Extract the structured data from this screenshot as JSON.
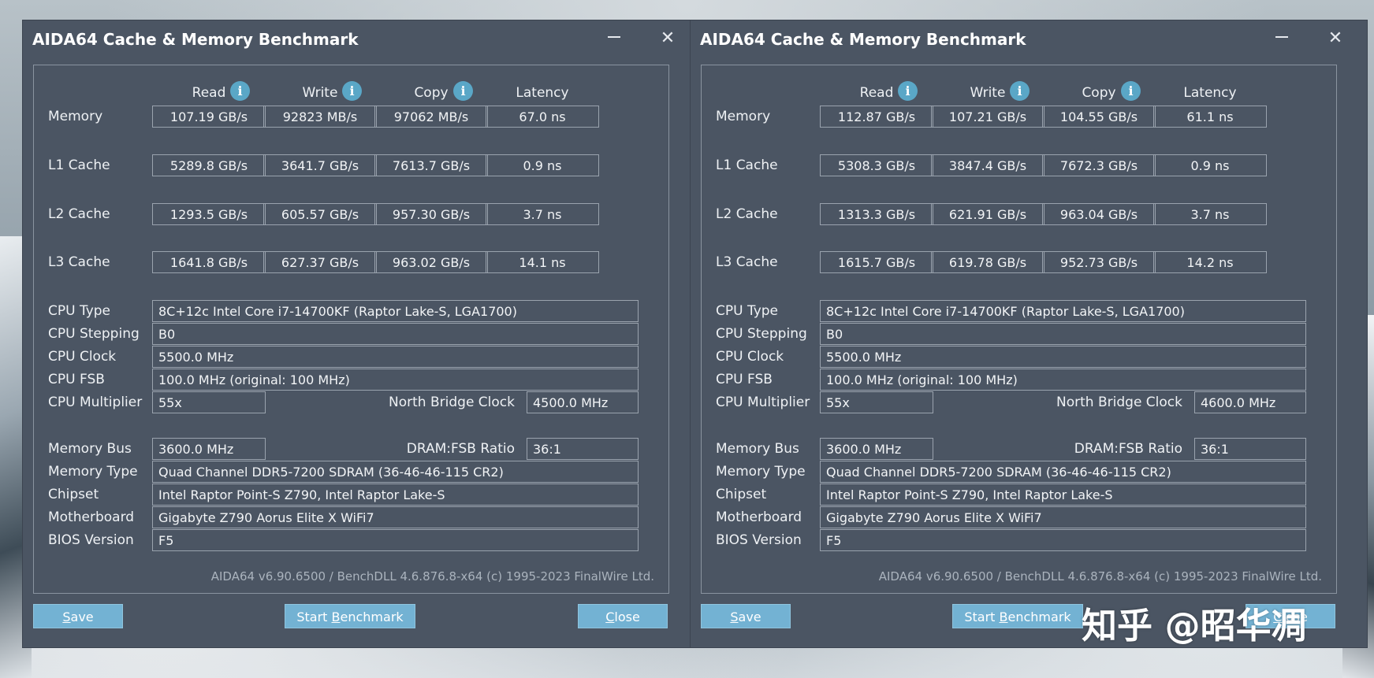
{
  "windows": [
    {
      "title": "AIDA64 Cache & Memory Benchmark",
      "columns": [
        "Read",
        "Write",
        "Copy",
        "Latency"
      ],
      "rows": [
        {
          "label": "Memory",
          "values": [
            "107.19 GB/s",
            "92823 MB/s",
            "97062 MB/s",
            "67.0 ns"
          ]
        },
        {
          "label": "L1 Cache",
          "values": [
            "5289.8 GB/s",
            "3641.7 GB/s",
            "7613.7 GB/s",
            "0.9 ns"
          ]
        },
        {
          "label": "L2 Cache",
          "values": [
            "1293.5 GB/s",
            "605.57 GB/s",
            "957.30 GB/s",
            "3.7 ns"
          ]
        },
        {
          "label": "L3 Cache",
          "values": [
            "1641.8 GB/s",
            "627.37 GB/s",
            "963.02 GB/s",
            "14.1 ns"
          ]
        }
      ],
      "cpu_info": [
        {
          "label": "CPU Type",
          "value": "8C+12c Intel Core i7-14700KF  (Raptor Lake-S, LGA1700)"
        },
        {
          "label": "CPU Stepping",
          "value": "B0"
        },
        {
          "label": "CPU Clock",
          "value": "5500.0 MHz"
        },
        {
          "label": "CPU FSB",
          "value": "100.0 MHz  (original: 100 MHz)"
        }
      ],
      "cpu_multiplier": {
        "label": "CPU Multiplier",
        "value": "55x",
        "nb_label": "North Bridge Clock",
        "nb_value": "4500.0 MHz"
      },
      "memory_bus": {
        "label": "Memory Bus",
        "value": "3600.0 MHz",
        "ratio_label": "DRAM:FSB Ratio",
        "ratio_value": "36:1"
      },
      "mem_info": [
        {
          "label": "Memory Type",
          "value": "Quad Channel DDR5-7200 SDRAM  (36-46-46-115 CR2)"
        },
        {
          "label": "Chipset",
          "value": "Intel Raptor Point-S Z790, Intel Raptor Lake-S"
        },
        {
          "label": "Motherboard",
          "value": "Gigabyte Z790 Aorus Elite X WiFi7"
        },
        {
          "label": "BIOS Version",
          "value": "F5"
        }
      ],
      "footer": "AIDA64 v6.90.6500 / BenchDLL 4.6.876.8-x64  (c) 1995-2023 FinalWire Ltd.",
      "buttons": {
        "save": {
          "u": "S",
          "rest": "ave"
        },
        "start": {
          "pre": "Start ",
          "u": "B",
          "rest": "enchmark"
        },
        "close": {
          "u": "C",
          "rest": "lose"
        }
      }
    },
    {
      "title": "AIDA64 Cache & Memory Benchmark",
      "columns": [
        "Read",
        "Write",
        "Copy",
        "Latency"
      ],
      "rows": [
        {
          "label": "Memory",
          "values": [
            "112.87 GB/s",
            "107.21 GB/s",
            "104.55 GB/s",
            "61.1 ns"
          ]
        },
        {
          "label": "L1 Cache",
          "values": [
            "5308.3 GB/s",
            "3847.4 GB/s",
            "7672.3 GB/s",
            "0.9 ns"
          ]
        },
        {
          "label": "L2 Cache",
          "values": [
            "1313.3 GB/s",
            "621.91 GB/s",
            "963.04 GB/s",
            "3.7 ns"
          ]
        },
        {
          "label": "L3 Cache",
          "values": [
            "1615.7 GB/s",
            "619.78 GB/s",
            "952.73 GB/s",
            "14.2 ns"
          ]
        }
      ],
      "cpu_info": [
        {
          "label": "CPU Type",
          "value": "8C+12c Intel Core i7-14700KF  (Raptor Lake-S, LGA1700)"
        },
        {
          "label": "CPU Stepping",
          "value": "B0"
        },
        {
          "label": "CPU Clock",
          "value": "5500.0 MHz"
        },
        {
          "label": "CPU FSB",
          "value": "100.0 MHz  (original: 100 MHz)"
        }
      ],
      "cpu_multiplier": {
        "label": "CPU Multiplier",
        "value": "55x",
        "nb_label": "North Bridge Clock",
        "nb_value": "4600.0 MHz"
      },
      "memory_bus": {
        "label": "Memory Bus",
        "value": "3600.0 MHz",
        "ratio_label": "DRAM:FSB Ratio",
        "ratio_value": "36:1"
      },
      "mem_info": [
        {
          "label": "Memory Type",
          "value": "Quad Channel DDR5-7200 SDRAM  (36-46-46-115 CR2)"
        },
        {
          "label": "Chipset",
          "value": "Intel Raptor Point-S Z790, Intel Raptor Lake-S"
        },
        {
          "label": "Motherboard",
          "value": "Gigabyte Z790 Aorus Elite X WiFi7"
        },
        {
          "label": "BIOS Version",
          "value": "F5"
        }
      ],
      "footer": "AIDA64 v6.90.6500 / BenchDLL 4.6.876.8-x64  (c) 1995-2023 FinalWire Ltd.",
      "buttons": {
        "save": {
          "u": "S",
          "rest": "ave"
        },
        "start": {
          "pre": "Start ",
          "u": "B",
          "rest": "enchmark"
        },
        "close": {
          "u": "C",
          "rest": "lose"
        }
      }
    }
  ],
  "watermark": "知乎 @昭华凋",
  "icons": {
    "info": "info-icon",
    "minimize": "minimize-icon",
    "close": "close-icon"
  },
  "colors": {
    "window_bg": "#4b5563",
    "button_bg": "#73b2d3",
    "info_icon": "#5aa7c7",
    "text": "#eef1f4"
  }
}
